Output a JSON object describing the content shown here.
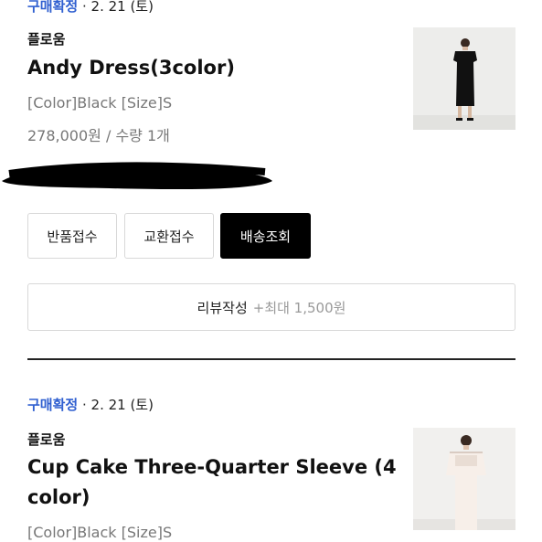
{
  "orders": [
    {
      "status": "구매확정",
      "date": "· 2. 21 (토)",
      "brand": "플로움",
      "title": "Andy Dress(3color)",
      "option": "[Color]Black [Size]S",
      "price_qty": "278,000원 / 수량 1개",
      "buttons": [
        "반품접수",
        "교환접수",
        "배송조회"
      ],
      "review_label": "리뷰작성",
      "review_bonus": "+최대 1,500원"
    },
    {
      "status": "구매확정",
      "date": "· 2. 21 (토)",
      "brand": "플로움",
      "title_line1": "Cup Cake Three-Quarter Sleeve (4",
      "title_line2": "color)",
      "option": "[Color]Black [Size]S"
    }
  ],
  "colors": {
    "status": "#2f5fd0",
    "dark_button": "#000000",
    "divider": "#222222"
  }
}
